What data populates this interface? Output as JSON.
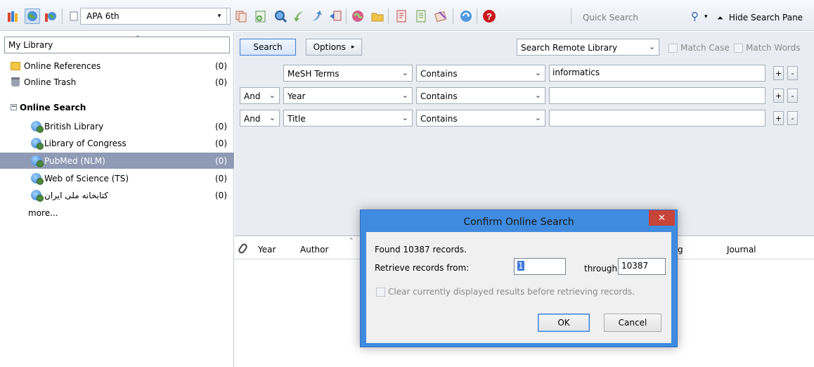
{
  "toolbar": {
    "style": "APA 6th",
    "quick_search_placeholder": "Quick Search",
    "hide_search_pane": "Hide Search Pane",
    "icons": [
      "local-library-icon",
      "online-library-icon",
      "integrated-library-icon",
      "copy-icon",
      "new-reference-icon",
      "find-fulltext-icon",
      "import-icon",
      "export-icon",
      "open-link-icon",
      "online-search-icon",
      "open-file-icon",
      "insert-citation-icon",
      "format-bibliography-icon",
      "return-to-word-icon",
      "sync-icon",
      "help-icon"
    ]
  },
  "sidebar": {
    "library_dropdown": "My Library",
    "items": [
      {
        "label": "Online References",
        "count": "(0)"
      },
      {
        "label": "Online Trash",
        "count": "(0)"
      }
    ],
    "group_label": "Online Search",
    "search_items": [
      {
        "label": "British Library",
        "count": "(0)"
      },
      {
        "label": "Library of Congress",
        "count": "(0)"
      },
      {
        "label": "PubMed (NLM)",
        "count": "(0)"
      },
      {
        "label": "Web of Science (TS)",
        "count": "(0)"
      },
      {
        "label": "کتابخانه ملی ایران",
        "count": "(0)"
      }
    ],
    "more": "more..."
  },
  "search": {
    "search_button": "Search",
    "options_button": "Options",
    "options_arrow": "▸",
    "remote_select": "Search Remote Library",
    "match_case": "Match Case",
    "match_words": "Match Words",
    "rows": [
      {
        "bool": "",
        "field": "MeSH Terms",
        "op": "Contains",
        "value": "informatics"
      },
      {
        "bool": "And",
        "field": "Year",
        "op": "Contains",
        "value": ""
      },
      {
        "bool": "And",
        "field": "Title",
        "op": "Contains",
        "value": ""
      }
    ],
    "plus": "+",
    "minus": "-"
  },
  "results": {
    "columns": [
      "Year",
      "Author",
      "g",
      "Journal"
    ]
  },
  "dialog": {
    "title": "Confirm Online Search",
    "close": "✕",
    "found": "Found 10387 records.",
    "retrieve_label": "Retrieve records from:",
    "from_value": "1",
    "through_label": "through",
    "to_value": "10387",
    "clear_label": "Clear currently displayed results before retrieving records.",
    "ok": "OK",
    "cancel": "Cancel"
  }
}
